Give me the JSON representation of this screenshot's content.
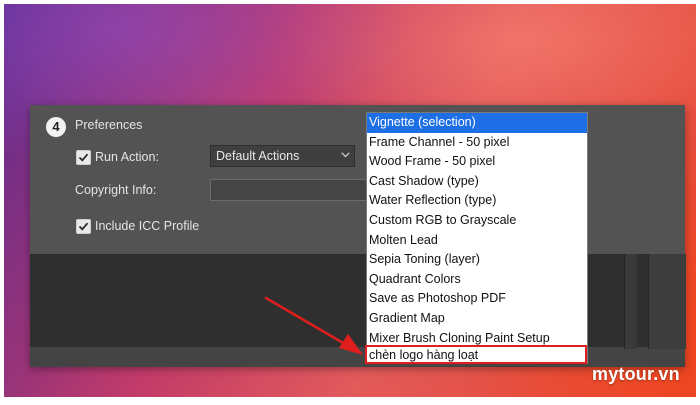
{
  "section": {
    "step_number": "4",
    "title": "Preferences"
  },
  "run_action": {
    "checked": true,
    "label": "Run Action:",
    "selected_set": "Default Actions"
  },
  "copyright": {
    "label": "Copyright Info:",
    "value": ""
  },
  "icc": {
    "checked": true,
    "label": "Include ICC Profile"
  },
  "action_list": {
    "selected_index": 0,
    "items": [
      "Vignette (selection)",
      "Frame Channel - 50 pixel",
      "Wood Frame - 50 pixel",
      "Cast Shadow (type)",
      "Water Reflection (type)",
      "Custom RGB to Grayscale",
      "Molten Lead",
      "Sepia Toning (layer)",
      "Quadrant Colors",
      "Save as Photoshop PDF",
      "Gradient Map",
      "Mixer Brush Cloning Paint Setup",
      "chèn logo hàng loạt"
    ]
  },
  "colors": {
    "panel": "#535353",
    "selection": "#1e6fe6",
    "annotation": "#e01e1e"
  },
  "watermark": "mytour.vn"
}
